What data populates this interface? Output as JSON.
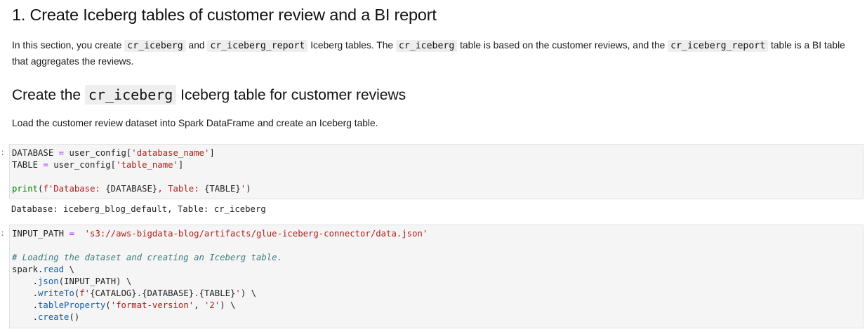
{
  "heading1": "1. Create Iceberg tables of customer review and a BI report",
  "intro": {
    "t1": "In this section, you create ",
    "c1": "cr_iceberg",
    "t2": " and ",
    "c2": "cr_iceberg_report",
    "t3": " Iceberg tables. The ",
    "c3": "cr_iceberg",
    "t4": " table is based on the customer reviews, and the ",
    "c4": "cr_iceberg_report",
    "t5": " table is a BI table that aggregates the reviews."
  },
  "heading2": {
    "pre": "Create the ",
    "code": "cr_iceberg",
    "post": " Iceberg table for customer reviews"
  },
  "para2": "Load the customer review dataset into Spark DataFrame and create an Iceberg table.",
  "cell1": {
    "prompt": ":",
    "l1": {
      "a": "DATABASE ",
      "op": "=",
      "b": " user_config[",
      "s": "'database_name'",
      "c": "]"
    },
    "l2": {
      "a": "TABLE ",
      "op": "=",
      "b": " user_config[",
      "s": "'table_name'",
      "c": "]"
    },
    "l4": {
      "fn": "print",
      "p": "(",
      "s1": "f'Database: ",
      "v1": "{DATABASE}",
      "s2": ", Table: ",
      "v2": "{TABLE}",
      "s3": "'",
      "c": ")"
    },
    "output": "Database: iceberg_blog_default, Table: cr_iceberg"
  },
  "cell2": {
    "prompt": ":",
    "l1": {
      "a": "INPUT_PATH ",
      "op": "=",
      "b": "  ",
      "s": "'s3://aws-bigdata-blog/artifacts/glue-iceberg-connector/data.json'"
    },
    "comment": "# Loading the dataset and creating an Iceberg table.",
    "l4": {
      "a": "spark",
      "d": ".",
      "attr": "read",
      "c": " \\"
    },
    "l5": {
      "ind": "    ",
      "d": ".",
      "attr": "json",
      "c": "(INPUT_PATH) \\"
    },
    "l6": {
      "ind": "    ",
      "d": ".",
      "attr": "writeTo",
      "p": "(",
      "s1": "f'",
      "v": "{CATALOG}",
      "s2": ".",
      "v2": "{DATABASE}",
      "s3": ".",
      "v3": "{TABLE}",
      "s4": "'",
      "c": ") \\"
    },
    "l7": {
      "ind": "    ",
      "d": ".",
      "attr": "tableProperty",
      "p": "(",
      "s1": "'format-version'",
      "m": ", ",
      "s2": "'2'",
      "c": ") \\"
    },
    "l8": {
      "ind": "    ",
      "d": ".",
      "attr": "create",
      "c": "()"
    }
  }
}
